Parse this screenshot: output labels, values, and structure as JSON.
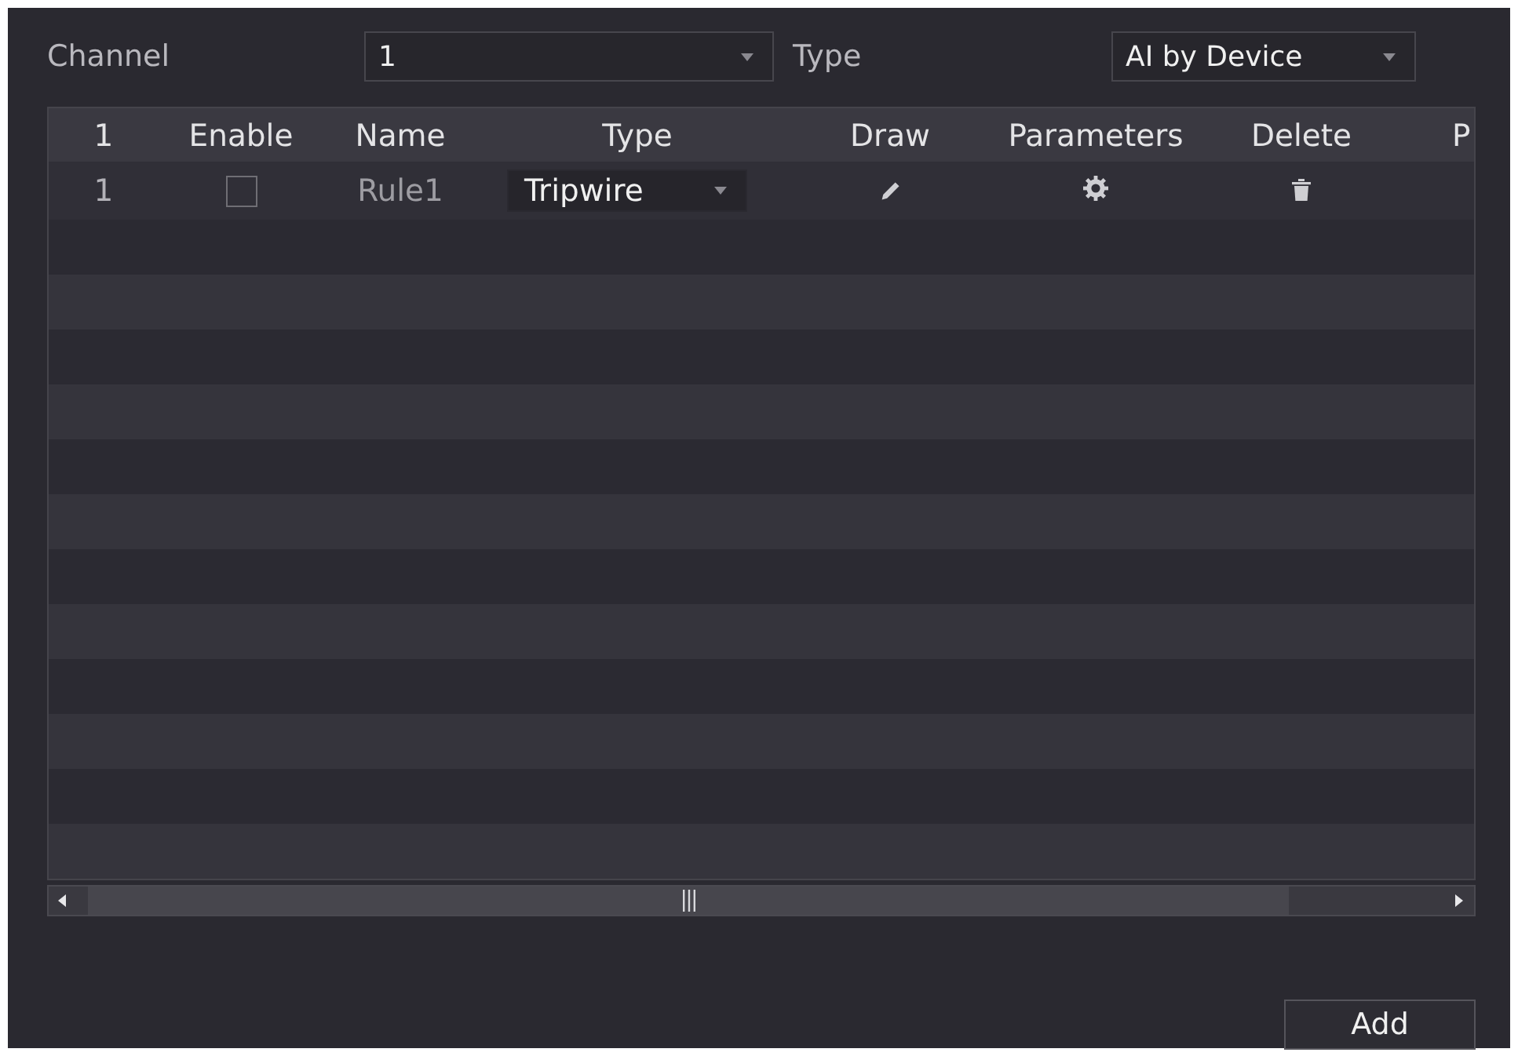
{
  "filters": [
    {
      "label": "Channel",
      "value": "1"
    },
    {
      "label": "Type",
      "value": "AI by Device"
    }
  ],
  "table": {
    "columns": [
      "1",
      "Enable",
      "Name",
      "Type",
      "Draw",
      "Parameters",
      "Delete",
      "P"
    ],
    "rows": [
      {
        "number": "1",
        "enabled": false,
        "name": "Rule1",
        "type": "Tripwire"
      }
    ]
  },
  "buttons": [
    "Add"
  ]
}
